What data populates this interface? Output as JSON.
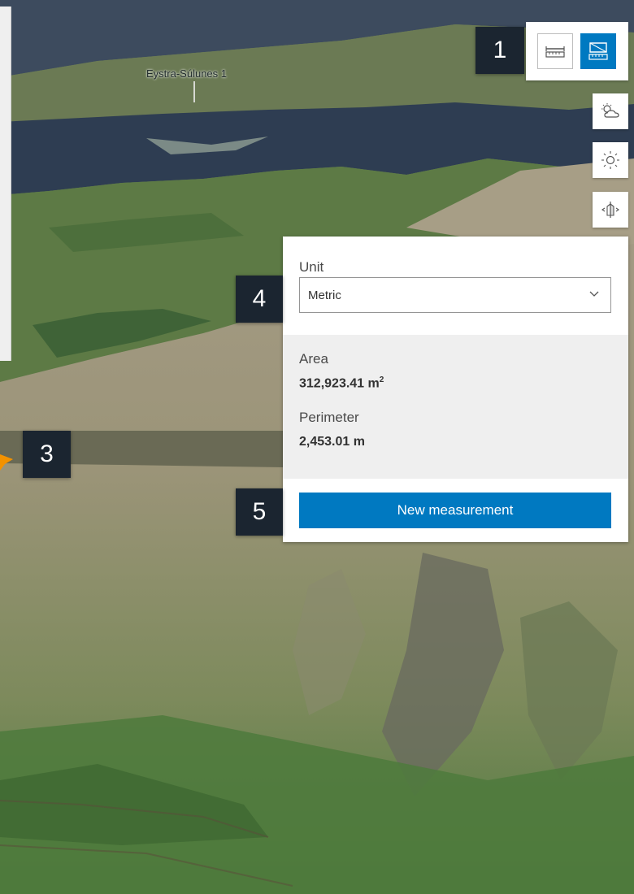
{
  "map": {
    "place_label": "Eystra-Súlunes 1"
  },
  "callouts": {
    "c1": "1",
    "c3": "3",
    "c4": "4",
    "c5": "5"
  },
  "toolbar": {
    "distance_icon": "ruler-line-icon",
    "area_icon": "ruler-area-icon",
    "active_tool": "area"
  },
  "side_tools": [
    "weather-icon",
    "sun-icon",
    "slice-icon"
  ],
  "panel": {
    "unit_label": "Unit",
    "unit_value": "Metric",
    "area_label": "Area",
    "area_value": "312,923.41 m",
    "area_unit_sup": "2",
    "perimeter_label": "Perimeter",
    "perimeter_value": "2,453.01 m",
    "new_button": "New measurement"
  },
  "colors": {
    "accent": "#0079c1",
    "callout_bg": "#1b2530",
    "results_bg": "#efefef",
    "measure_marker": "#f39200"
  }
}
